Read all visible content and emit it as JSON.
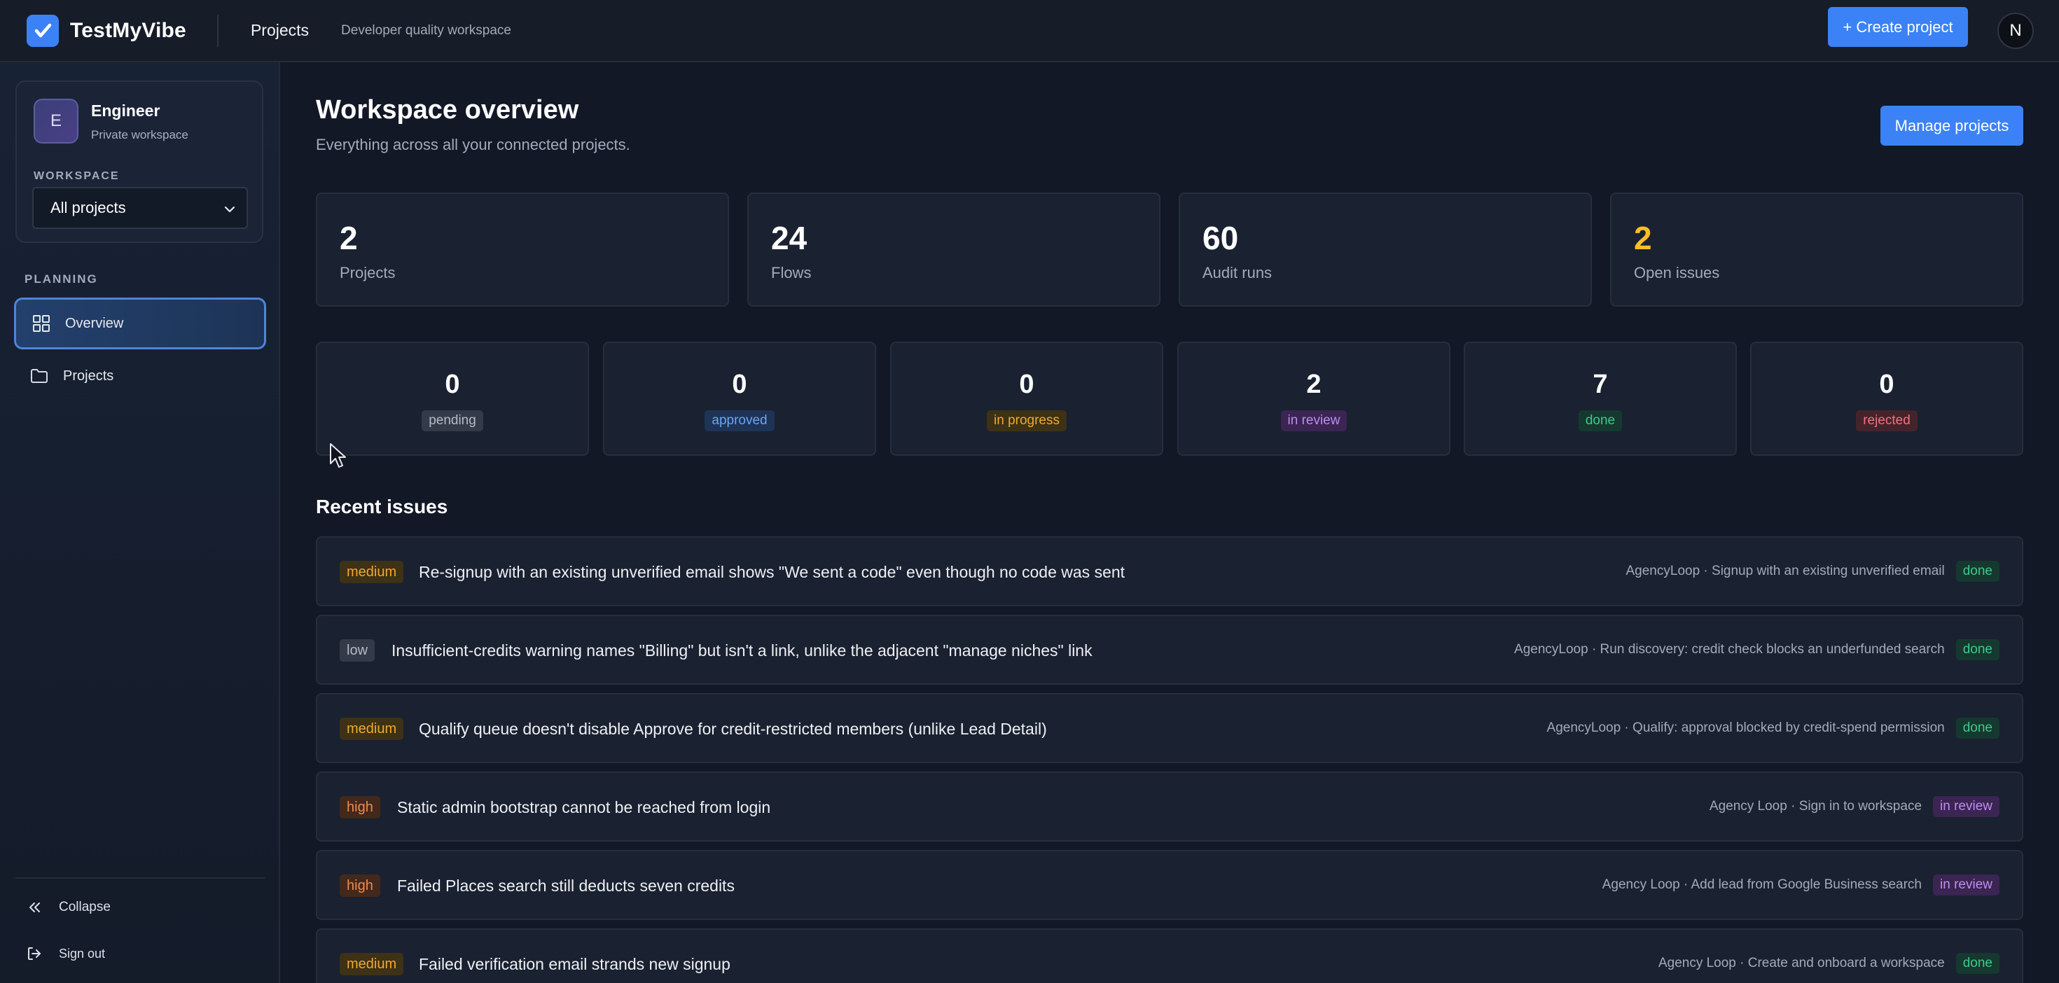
{
  "brand": {
    "name": "TestMyVibe"
  },
  "topbar": {
    "nav_projects": "Projects",
    "subtitle": "Developer quality workspace",
    "create_button": "+ Create project",
    "avatar_initial": "N"
  },
  "sidebar": {
    "user": {
      "initial": "E",
      "name": "Engineer",
      "subtitle": "Private workspace"
    },
    "workspace_label": "WORKSPACE",
    "workspace_selected": "All projects",
    "planning_label": "PLANNING",
    "items": [
      {
        "label": "Overview",
        "icon": "grid-icon",
        "active": true
      },
      {
        "label": "Projects",
        "icon": "folder-icon",
        "active": false
      }
    ],
    "collapse_label": "Collapse",
    "signout_label": "Sign out"
  },
  "main": {
    "title": "Workspace overview",
    "subtitle": "Everything across all your connected projects.",
    "manage_button": "Manage projects",
    "stats": [
      {
        "value": "2",
        "label": "Projects"
      },
      {
        "value": "24",
        "label": "Flows"
      },
      {
        "value": "60",
        "label": "Audit runs"
      },
      {
        "value": "2",
        "label": "Open issues",
        "accent": "#fbbf24"
      }
    ],
    "statuses": [
      {
        "value": "0",
        "label": "pending"
      },
      {
        "value": "0",
        "label": "approved"
      },
      {
        "value": "0",
        "label": "in progress"
      },
      {
        "value": "2",
        "label": "in review"
      },
      {
        "value": "7",
        "label": "done"
      },
      {
        "value": "0",
        "label": "rejected"
      }
    ],
    "recent_heading": "Recent issues",
    "issues": [
      {
        "severity": "medium",
        "title": "Re-signup with an existing unverified email shows \"We sent a code\" even though no code was sent",
        "meta": "AgencyLoop · Signup with an existing unverified email",
        "status": "done"
      },
      {
        "severity": "low",
        "title": "Insufficient-credits warning names \"Billing\" but isn't a link, unlike the adjacent \"manage niches\" link",
        "meta": "AgencyLoop · Run discovery: credit check blocks an underfunded search",
        "status": "done"
      },
      {
        "severity": "medium",
        "title": "Qualify queue doesn't disable Approve for credit-restricted members (unlike Lead Detail)",
        "meta": "AgencyLoop · Qualify: approval blocked by credit-spend permission",
        "status": "done"
      },
      {
        "severity": "high",
        "title": "Static admin bootstrap cannot be reached from login",
        "meta": "Agency Loop · Sign in to workspace",
        "status": "in review"
      },
      {
        "severity": "high",
        "title": "Failed Places search still deducts seven credits",
        "meta": "Agency Loop · Add lead from Google Business search",
        "status": "in review"
      },
      {
        "severity": "medium",
        "title": "Failed verification email strands new signup",
        "meta": "Agency Loop · Create and onboard a workspace",
        "status": "done"
      }
    ]
  },
  "colors": {
    "accent": "#3b82f6",
    "background": "#121826",
    "card": "#1a2130",
    "open_issues": "#fbbf24"
  }
}
